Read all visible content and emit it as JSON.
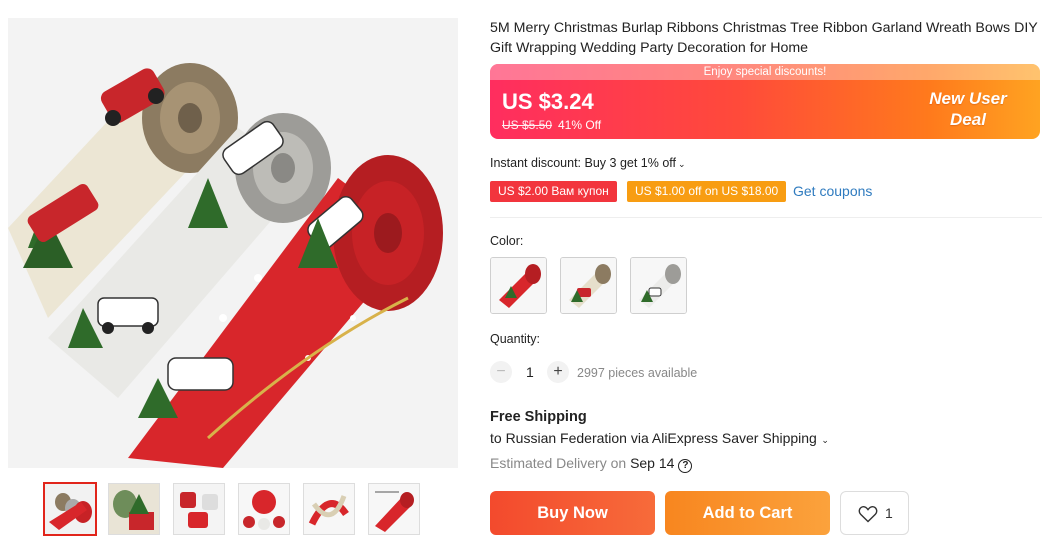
{
  "gallery": {
    "main_image_name": "christmas-ribbon-rolls-photo",
    "thumbnails": [
      {
        "name": "thumb-three-rolls",
        "active": true
      },
      {
        "name": "thumb-burlap-tree"
      },
      {
        "name": "thumb-red-truck-rolls"
      },
      {
        "name": "thumb-bows-set"
      },
      {
        "name": "thumb-ribbon-swirl"
      },
      {
        "name": "thumb-measurement"
      }
    ]
  },
  "product": {
    "title": "5M Merry Christmas Burlap Ribbons Christmas Tree Ribbon Garland Wreath Bows DIY Gift Wrapping Wedding Party Decoration for Home"
  },
  "price": {
    "banner": "Enjoy special discounts!",
    "current": "US $3.24",
    "original": "US $5.50",
    "discount": "41% Off",
    "promo_line1": "New User",
    "promo_line2": "Deal"
  },
  "discounts": {
    "instant_text": "Instant discount: Buy 3 get 1% off",
    "coupon1": "US $2.00 Вам купон",
    "coupon2": "US $1.00 off on US $18.00",
    "get_coupons": "Get coupons"
  },
  "variants": {
    "color_label": "Color:",
    "colors": [
      {
        "name": "color-red-print"
      },
      {
        "name": "color-burlap-print"
      },
      {
        "name": "color-white-print"
      }
    ]
  },
  "quantity": {
    "label": "Quantity:",
    "minus": "−",
    "value": "1",
    "plus": "+",
    "available": "2997 pieces available"
  },
  "shipping": {
    "title": "Free Shipping",
    "destination": "to Russian Federation via AliExpress Saver Shipping",
    "delivery_prefix": "Estimated Delivery on",
    "delivery_date": "Sep 14"
  },
  "actions": {
    "buy_now": "Buy Now",
    "add_to_cart": "Add to Cart",
    "wishlist_count": "1"
  },
  "colors": {
    "accent_red": "#f34a2d",
    "accent_orange": "#f8861f",
    "link_blue": "#2f7bbf",
    "coupon_red": "#f2353d",
    "coupon_orange": "#f89d12"
  }
}
